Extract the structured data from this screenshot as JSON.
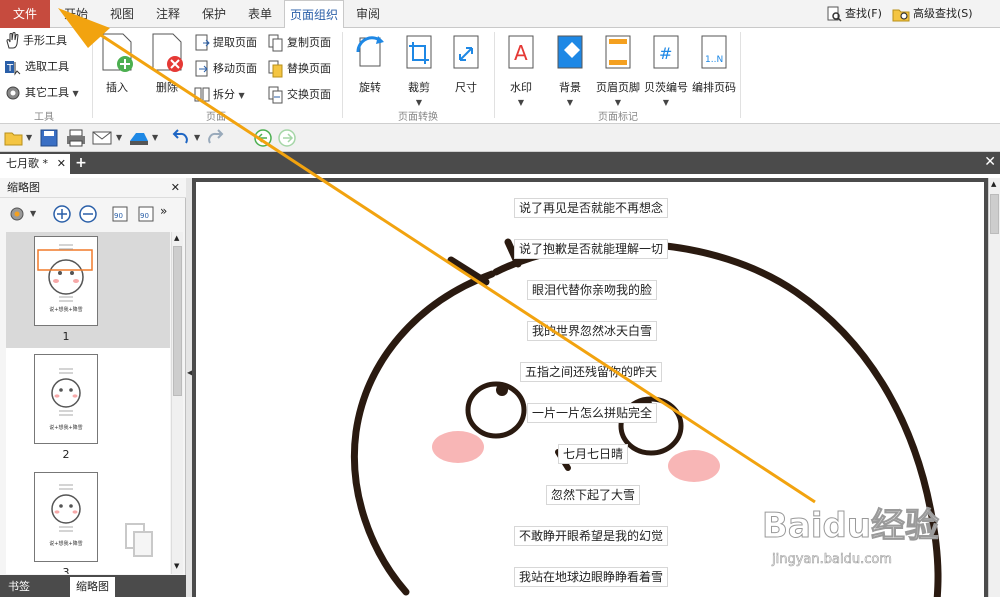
{
  "menu": {
    "tabs": [
      "文件",
      "开始",
      "视图",
      "注释",
      "保护",
      "表单",
      "页面组织",
      "审阅"
    ],
    "active": "页面组织",
    "find_label": "查找(F)",
    "adv_find_label": "高级查找(S)"
  },
  "ribbon": {
    "tools": {
      "hand": "手形工具",
      "select": "选取工具",
      "other": "其它工具",
      "group": "工具"
    },
    "pages": {
      "insert": "插入",
      "delete": "删除",
      "extract": "提取页面",
      "move": "移动页面",
      "split": "拆分",
      "copy": "复制页面",
      "replace": "替换页面",
      "swap": "交换页面",
      "group": "页面"
    },
    "transform": {
      "rotate": "旋转",
      "crop": "裁剪",
      "size": "尺寸",
      "group": "页面转换"
    },
    "marks": {
      "watermark": "水印",
      "background": "背景",
      "header_footer": "页眉页脚",
      "bates": "贝茨编号",
      "numbering": "编排页码",
      "group": "页面标记"
    }
  },
  "doc_tab": {
    "title": "七月歌 *"
  },
  "left_panel": {
    "title": "缩略图",
    "thumbs": [
      {
        "num": "1"
      },
      {
        "num": "2"
      },
      {
        "num": "3"
      }
    ],
    "bottom_tabs": [
      "书签",
      "缩略图"
    ],
    "thumb_caption": "说+想我+降雪"
  },
  "document": {
    "lines": [
      "说了再见是否就能不再想念",
      "说了抱歉是否就能理解一切",
      "眼泪代替你亲吻我的脸",
      "我的世界忽然冰天白雪",
      "五指之间还残留你的昨天",
      "一片一片怎么拼贴完全",
      "七月七日晴",
      "忽然下起了大雪",
      "不敢睁开眼希望是我的幻觉",
      "我站在地球边眼睁睁看着雪"
    ]
  },
  "watermark": {
    "logo": "Baidu经验",
    "url": "jingyan.baidu.com"
  },
  "colors": {
    "file_tab": "#c64b3e",
    "accent": "#2a5fa8",
    "arrow": "#f2a30f",
    "dark_bar": "#4b4b4b",
    "cheek": "#f7a9a9"
  }
}
